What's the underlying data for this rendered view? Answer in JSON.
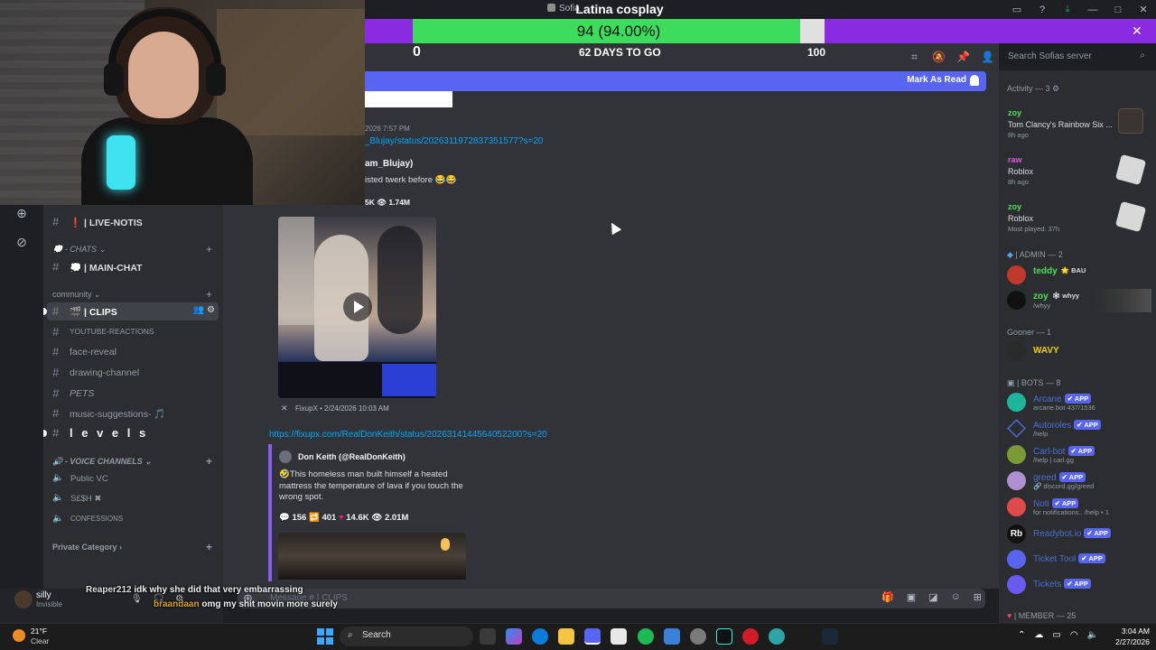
{
  "window": {
    "server_tag": "Sofia",
    "overlay_title": "Latina cosplay"
  },
  "goal": {
    "value_label": "94 (94.00%)",
    "progress_fraction": 0.94,
    "min": "0",
    "max": "100",
    "days_label": "62 DAYS TO GO",
    "fill_color": "#3ddc5c",
    "bar_color": "#8a2be2"
  },
  "header": {
    "search_placeholder": "Search Sofias server"
  },
  "chat": {
    "new_msg_button": "Mark As Read",
    "msg1_timestamp": "2026 7:57 PM",
    "msg1_link": "_Blujay/status/2026311972837351577?s=20",
    "embed1_author": "am_Blujay)",
    "embed1_text": "isted twerk before 😂😂",
    "embed1_stats": "5K  👁 1.74M",
    "embed1_footer": "FixupX • 2/24/2026 10:03 AM",
    "msg2_link": "https://fixupx.com/RealDonKeith/status/2026314144564052200?s=20",
    "embed2_author": "Don Keith (@RealDonKeith)",
    "embed2_text": "🤣This homeless man built himself a heated mattress the temperature of lava if you touch the wrong spot.",
    "embed2_stats": {
      "replies": "156",
      "reposts": "401",
      "likes": "14.6K",
      "views": "2.01M"
    },
    "input_placeholder": "Message #  | CLIPS"
  },
  "channels": [
    {
      "name": "❗ | LIVE-NOTIS",
      "bold": true
    },
    {
      "name": "💭 | MAIN-CHAT",
      "bold": true
    },
    {
      "name": "🎬 | CLIPS",
      "active": true
    },
    {
      "name": "YOUTUBE-REACTIONS"
    },
    {
      "name": "face-reveal"
    },
    {
      "name": "drawing-channel"
    },
    {
      "name": "PETS"
    },
    {
      "name": "music-suggestions- 🎵"
    },
    {
      "name": "l e v e l s",
      "big": true
    }
  ],
  "categories": {
    "chats": "💭 - CHATS",
    "community": "community",
    "voice": "🔊 - VOICE CHANNELS",
    "private": "Private Category"
  },
  "voice_channels": [
    "Public VC",
    "S£$H ✖",
    "CONFESSIONS"
  ],
  "user": {
    "name": "silly",
    "status": "Invisible"
  },
  "overlay_chat": [
    {
      "user": "Reaper212",
      "text": "idk why she did that very embarrassing"
    },
    {
      "user": "braandaan",
      "text": "omg my shit movin more surely"
    }
  ],
  "members": {
    "activity_head": "Activity — 3",
    "activities": [
      {
        "user": "zoy",
        "game": "Tom Clancy's Rainbow Six ...",
        "time": "8h ago",
        "user_color": "#4ae05a"
      },
      {
        "user": "raw",
        "game": "Roblox",
        "time": "8h ago",
        "user_color": "#e05ae0"
      },
      {
        "user": "zoy",
        "game": "Roblox",
        "time": "Most played: 37h",
        "user_color": "#4ae05a"
      }
    ],
    "admin_head": "ADMIN — 2",
    "admins": [
      {
        "name": "teddy",
        "tag": "🌟 BAU",
        "color": "#4ae05a"
      },
      {
        "name": "zoy",
        "tag": "🕸 whyy",
        "sub": "/whyy",
        "color": "#4ae05a"
      }
    ],
    "gooner_head": "Gooner — 1",
    "gooners": [
      {
        "name": "WAVY",
        "color": "#f0d000"
      }
    ],
    "bots_head": "BOTS — 8",
    "bots": [
      {
        "name": "Arcane",
        "sub": "arcane.bot 437/1536",
        "color": "#4c6fd1"
      },
      {
        "name": "Autoroles",
        "sub": "/help",
        "color": "#4c6fd1"
      },
      {
        "name": "Carl-bot",
        "sub": "/help | carl.gg",
        "color": "#4c6fd1"
      },
      {
        "name": "greed",
        "sub": "🔗 discord.gg/greed",
        "color": "#4c6fd1"
      },
      {
        "name": "Noti",
        "sub": "for notifications.. /help • 1",
        "color": "#4c6fd1"
      },
      {
        "name": "Readybot.io",
        "sub": "",
        "color": "#4c6fd1"
      },
      {
        "name": "Ticket Tool",
        "sub": "",
        "color": "#4c6fd1"
      },
      {
        "name": "Tickets",
        "sub": "",
        "color": "#4c6fd1"
      }
    ],
    "app_badge": "✔ APP",
    "member_head": "MEMBER — 25"
  },
  "taskbar": {
    "temp": "21°F",
    "condition": "Clear",
    "search": "Search",
    "time": "3:04 AM",
    "date": "2/27/2026"
  }
}
